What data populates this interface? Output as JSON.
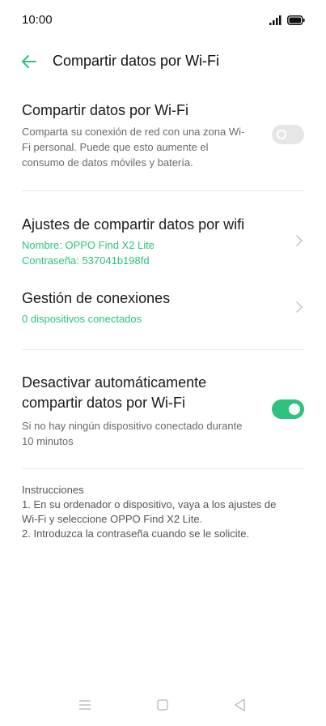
{
  "status_bar": {
    "time": "10:00",
    "signal_icon": "signal-icon",
    "battery_icon": "battery-icon"
  },
  "app_bar": {
    "back_icon": "arrow-left-icon",
    "title": "Compartir datos por Wi-Fi"
  },
  "hotspot": {
    "title": "Compartir datos por Wi-Fi",
    "description": "Comparta su conexión de red con una zona Wi-Fi personal. Puede que esto aumente el consumo de datos móviles y batería.",
    "enabled": false
  },
  "settings": {
    "title": "Ajustes de compartir datos por wifi",
    "name_line": "Nombre: OPPO Find X2 Lite",
    "password_line": "Contraseña: 537041b198fd"
  },
  "connections": {
    "title": "Gestión de conexiones",
    "subtitle": "0 dispositivos conectados"
  },
  "auto_off": {
    "title_line1": "Desactivar automáticamente",
    "title_line2": "compartir datos por Wi-Fi",
    "description_line1": "Si no hay ningún dispositivo conectado durante",
    "description_line2": "10 minutos",
    "enabled": true
  },
  "instructions": {
    "heading": "Instrucciones",
    "step1_line1": "1. En su ordenador o dispositivo, vaya a los ajustes de",
    "step1_line2": "Wi-Fi y seleccione OPPO Find X2 Lite.",
    "step2": "2. Introduzca la contraseña cuando se le solicite."
  },
  "colors": {
    "accent": "#2ec27e",
    "toggle_off": "#e6e6e6"
  },
  "nav_bar": {
    "icons": [
      "menu-icon",
      "home-square-icon",
      "back-triangle-icon"
    ]
  }
}
